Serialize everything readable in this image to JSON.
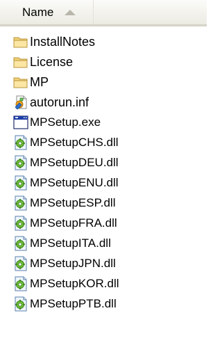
{
  "header": {
    "name_label": "Name"
  },
  "files": [
    {
      "name": "InstallNotes",
      "icon": "folder-icon"
    },
    {
      "name": "License",
      "icon": "folder-icon"
    },
    {
      "name": "MP",
      "icon": "folder-icon"
    },
    {
      "name": "autorun.inf",
      "icon": "setup-info-file-icon"
    },
    {
      "name": "MPSetup.exe",
      "icon": "application-exe-icon"
    },
    {
      "name": "MPSetupCHS.dll",
      "icon": "dll-file-icon"
    },
    {
      "name": "MPSetupDEU.dll",
      "icon": "dll-file-icon"
    },
    {
      "name": "MPSetupENU.dll",
      "icon": "dll-file-icon"
    },
    {
      "name": "MPSetupESP.dll",
      "icon": "dll-file-icon"
    },
    {
      "name": "MPSetupFRA.dll",
      "icon": "dll-file-icon"
    },
    {
      "name": "MPSetupITA.dll",
      "icon": "dll-file-icon"
    },
    {
      "name": "MPSetupJPN.dll",
      "icon": "dll-file-icon"
    },
    {
      "name": "MPSetupKOR.dll",
      "icon": "dll-file-icon"
    },
    {
      "name": "MPSetupPTB.dll",
      "icon": "dll-file-icon"
    }
  ]
}
